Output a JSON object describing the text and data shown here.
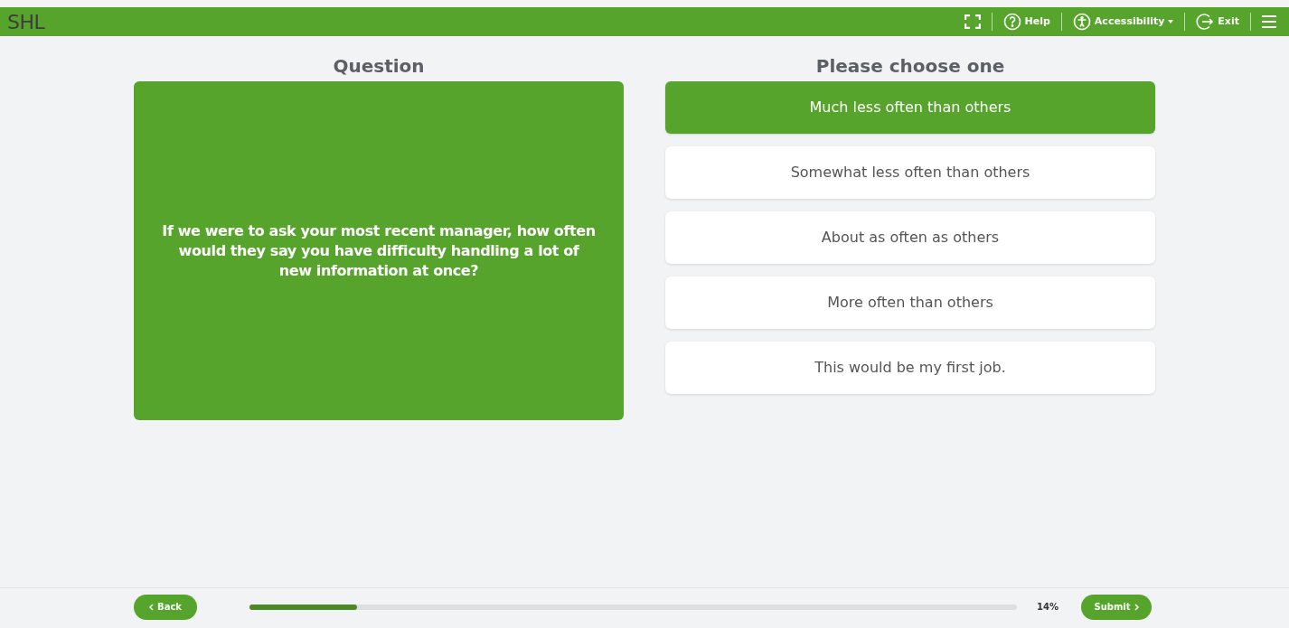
{
  "header": {
    "logo": "SHL",
    "actions": [
      {
        "kind": "fullscreen"
      },
      {
        "kind": "help",
        "label": "Help"
      },
      {
        "kind": "accessibility",
        "label": "Accessibility"
      },
      {
        "kind": "exit",
        "label": "Exit"
      },
      {
        "kind": "menu"
      }
    ]
  },
  "question": {
    "heading": "Question",
    "text": "If we were to ask your most recent manager, how often would they say you have difficulty handling a lot of new information at once?"
  },
  "answers": {
    "heading": "Please choose one",
    "options": [
      {
        "label": "Much less often than others",
        "selected": true
      },
      {
        "label": "Somewhat less often than others",
        "selected": false
      },
      {
        "label": "About as often as others",
        "selected": false
      },
      {
        "label": "More often than others",
        "selected": false
      },
      {
        "label": "This would be my first job.",
        "selected": false
      }
    ]
  },
  "footer": {
    "back": "Back",
    "progress": {
      "level": 0.14,
      "reading": "14%"
    },
    "submit": "Submit"
  }
}
